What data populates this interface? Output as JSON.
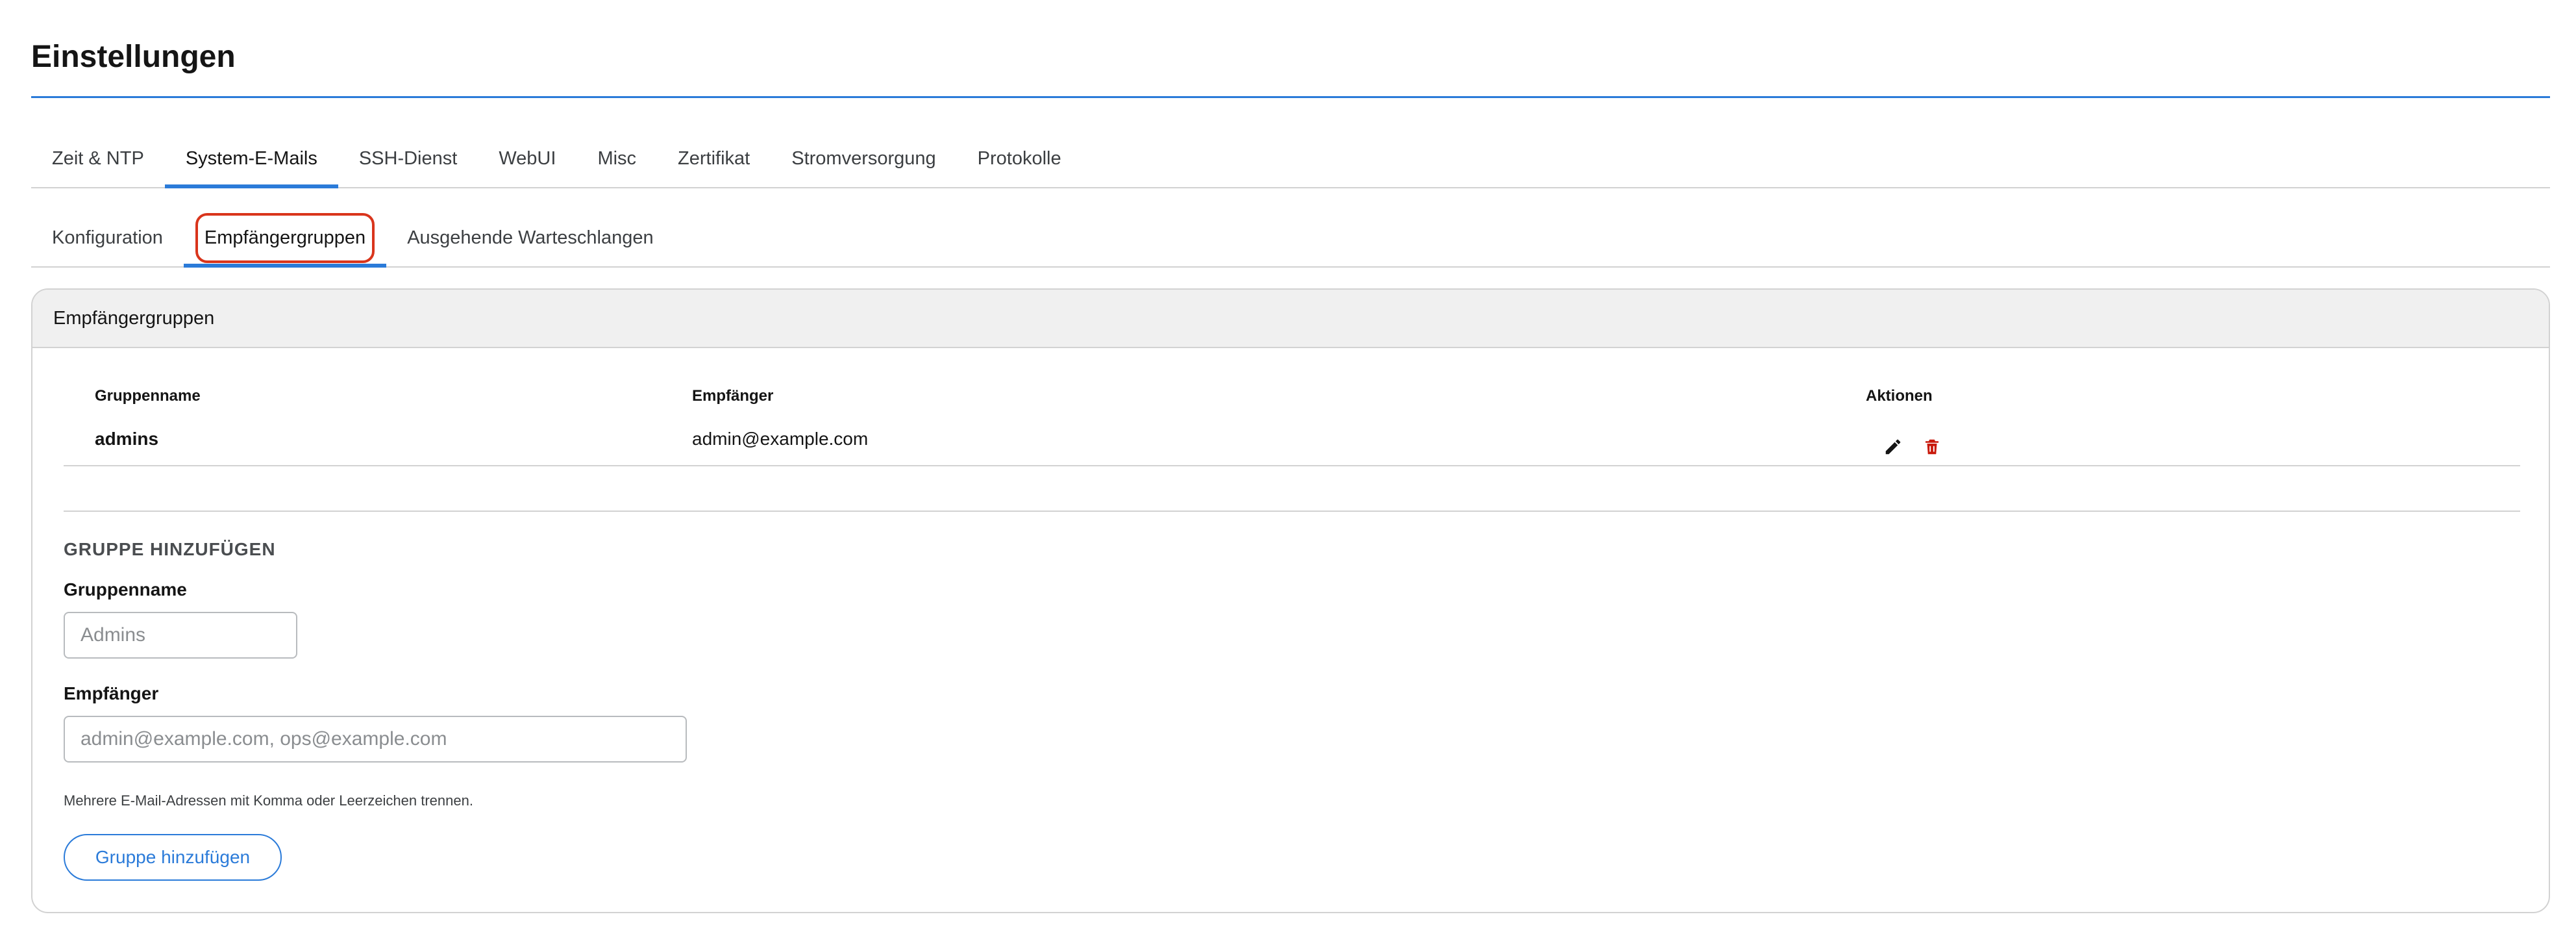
{
  "page": {
    "title": "Einstellungen"
  },
  "tabs": [
    {
      "label": "Zeit & NTP",
      "active": false
    },
    {
      "label": "System-E-Mails",
      "active": true
    },
    {
      "label": "SSH-Dienst",
      "active": false
    },
    {
      "label": "WebUI",
      "active": false
    },
    {
      "label": "Misc",
      "active": false
    },
    {
      "label": "Zertifikat",
      "active": false
    },
    {
      "label": "Stromversorgung",
      "active": false
    },
    {
      "label": "Protokolle",
      "active": false
    }
  ],
  "subtabs": [
    {
      "label": "Konfiguration",
      "active": false
    },
    {
      "label": "Empfängergruppen",
      "active": true
    },
    {
      "label": "Ausgehende Warteschlangen",
      "active": false
    }
  ],
  "card": {
    "title": "Empfängergruppen",
    "table": {
      "headers": {
        "name": "Gruppenname",
        "recipients": "Empfänger",
        "actions": "Aktionen"
      },
      "rows": [
        {
          "name": "admins",
          "recipients": "admin@example.com"
        }
      ]
    },
    "add_form": {
      "section_title": "GRUPPE HINZUFÜGEN",
      "name_label": "Gruppenname",
      "name_placeholder": "Admins",
      "name_value": "",
      "recipients_label": "Empfänger",
      "recipients_placeholder": "admin@example.com, ops@example.com",
      "recipients_value": "",
      "help_text": "Mehrere E-Mail-Adressen mit Komma oder Leerzeichen trennen.",
      "submit_label": "Gruppe hinzufügen"
    }
  },
  "icons": {
    "edit": "pencil-icon",
    "delete": "trash-icon"
  },
  "colors": {
    "accent": "#2b7bd9",
    "danger": "#c9190b",
    "highlight": "#d9351c"
  }
}
